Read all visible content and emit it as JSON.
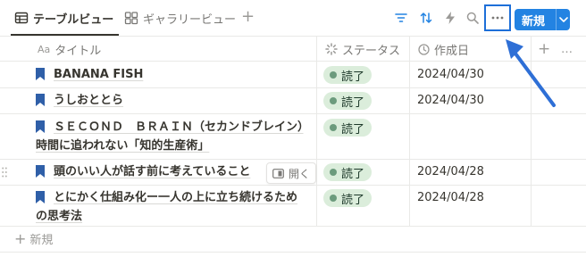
{
  "toolbar": {
    "tabs": [
      {
        "label": "テーブルビュー",
        "icon": "table-icon",
        "active": true
      },
      {
        "label": "ギャラリービュー",
        "icon": "gallery-icon",
        "active": false
      }
    ],
    "add_view_label": "+",
    "icons": [
      "filter-icon",
      "sort-icon",
      "automation-bolt-icon",
      "search-icon",
      "more-icon"
    ],
    "new_button_label": "新規",
    "accent_color": "#2383e2",
    "highlight_color": "#1d6fd8"
  },
  "table": {
    "columns": [
      {
        "label": "タイトル",
        "prefix": "Aa"
      },
      {
        "label": "ステータス",
        "icon": "status-spinner-icon"
      },
      {
        "label": "作成日",
        "icon": "clock-icon"
      }
    ],
    "add_column_label": "+",
    "more_columns_label": "…",
    "rows": [
      {
        "title": "BANANA FISH",
        "status": "読了",
        "date": "2024/04/30"
      },
      {
        "title": "うしおととら",
        "status": "読了",
        "date": "2024/04/30"
      },
      {
        "title": "ＳＥＣＯＮＤ　ＢＲＡＩＮ（セカンドブレイン）時間に追われない「知的生産術」",
        "status": "読了",
        "date": ""
      },
      {
        "title": "頭のいい人が話す前に考えていること",
        "status": "読了",
        "date": "2024/04/28",
        "open_label": "開く"
      },
      {
        "title": "とにかく仕組み化ー一人の上に立ち続けるための思考法",
        "status": "読了",
        "date": "2024/04/28"
      }
    ],
    "new_row_label": "新規",
    "status_color": "#dbeddb"
  }
}
